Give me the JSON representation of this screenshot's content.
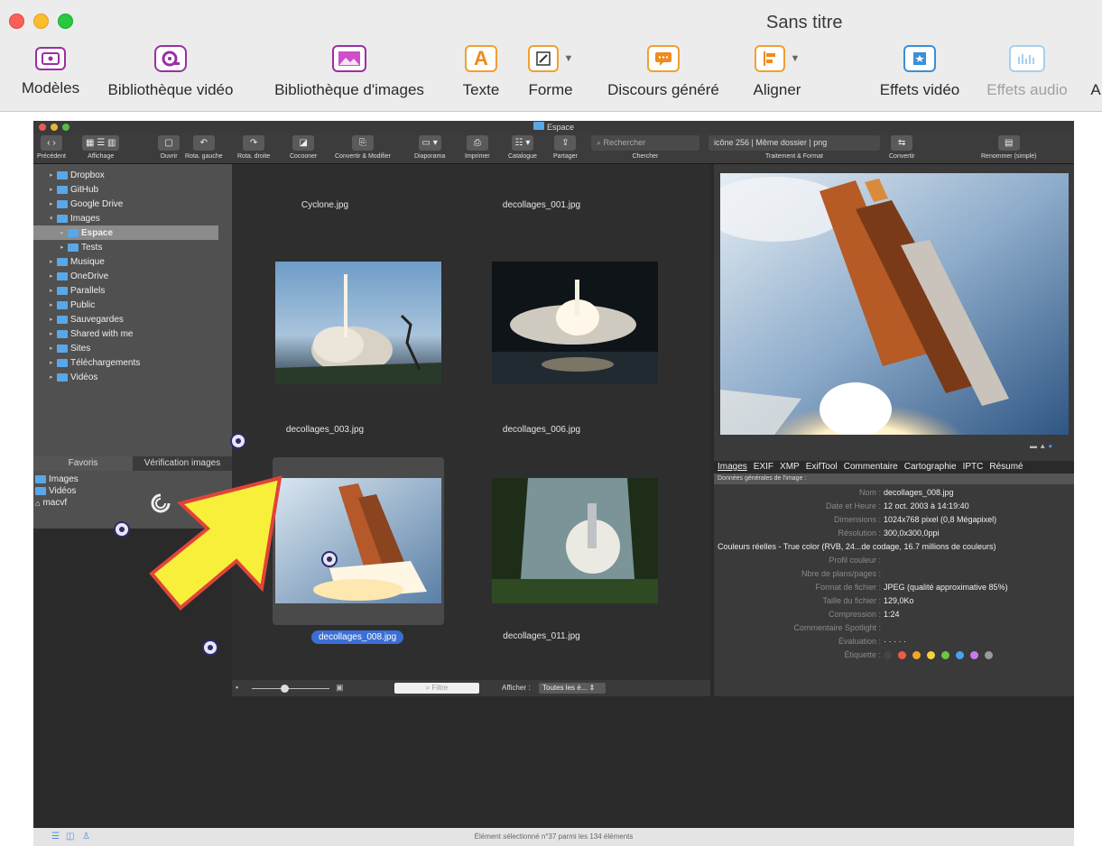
{
  "window": {
    "title": "Sans titre"
  },
  "toolbar": {
    "items": [
      {
        "label": "Modèles",
        "icon": "templates-icon"
      },
      {
        "label": "Bibliothèque vidéo",
        "icon": "video-library-icon"
      },
      {
        "label": "Bibliothèque d'images",
        "icon": "image-library-icon"
      },
      {
        "label": "Texte",
        "icon": "text-icon",
        "glyph": "A"
      },
      {
        "label": "Forme",
        "icon": "shape-icon"
      },
      {
        "label": "Discours généré",
        "icon": "speech-icon"
      },
      {
        "label": "Aligner",
        "icon": "align-icon"
      },
      {
        "label": "Effets vidéo",
        "icon": "video-effects-icon"
      },
      {
        "label": "Effets audio",
        "icon": "audio-effects-icon"
      },
      {
        "label": "A"
      }
    ]
  },
  "inner_window": {
    "title": "Espace",
    "toolbar": {
      "precedent": "Précédent",
      "affichage": "Affichage",
      "ouvrir": "Ouvrir",
      "rota_gauche": "Rota. gauche",
      "rota_droite": "Rota. droite",
      "cocooner": "Cocooner",
      "convertir_modifier": "Convertir & Modifier",
      "diaporama": "Diaporama",
      "imprimer": "Imprimer",
      "catalogue": "Catalogue",
      "partager": "Partager",
      "search_placeholder": "Rechercher",
      "chercher": "Chercher",
      "format_value": "icône 256 | Même dossier | png",
      "traitement": "Traitement & Format",
      "convertir": "Convertir",
      "renommer": "Renommer (simple)"
    },
    "sidebar": {
      "tree": [
        {
          "label": "Dropbox",
          "indent": 1
        },
        {
          "label": "GitHub",
          "indent": 1
        },
        {
          "label": "Google Drive",
          "indent": 1
        },
        {
          "label": "Images",
          "indent": 1
        },
        {
          "label": "Espace",
          "indent": 2
        },
        {
          "label": "Tests",
          "indent": 2
        },
        {
          "label": "Musique",
          "indent": 1
        },
        {
          "label": "OneDrive",
          "indent": 1
        },
        {
          "label": "Parallels",
          "indent": 1
        },
        {
          "label": "Public",
          "indent": 1
        },
        {
          "label": "Sauvegardes",
          "indent": 1
        },
        {
          "label": "Shared with me",
          "indent": 1
        },
        {
          "label": "Sites",
          "indent": 1
        },
        {
          "label": "Téléchargements",
          "indent": 1
        },
        {
          "label": "Vidéos",
          "indent": 1
        }
      ],
      "tabs": [
        "Favoris",
        "Vérification images"
      ],
      "favorites": [
        "Images",
        "Vidéos",
        "macvf"
      ]
    },
    "grid": {
      "captions": [
        "Cyclone.jpg",
        "decollages_001.jpg",
        "decollages_003.jpg",
        "decollages_006.jpg",
        "decollages_008.jpg",
        "decollages_011.jpg"
      ],
      "selected": "decollages_008.jpg",
      "filter_placeholder": "Filtre",
      "afficher_label": "Afficher :",
      "afficher_value": "Toutes les é..."
    },
    "info": {
      "tabs": [
        "Images",
        "EXIF",
        "XMP",
        "ExifTool",
        "Commentaire",
        "Cartographie",
        "IPTC",
        "Résumé"
      ],
      "header": "Données générales de l'image :",
      "rows": [
        {
          "k": "Nom :",
          "v": "decollages_008.jpg"
        },
        {
          "k": "Date et Heure :",
          "v": "12 oct. 2003 à 14:19:40"
        },
        {
          "k": "Dimensions :",
          "v": "1024x768 pixel (0,8 Mégapixel)"
        },
        {
          "k": "Résolution :",
          "v": "300,0x300,0ppi"
        },
        {
          "k": "",
          "v": "Couleurs réelles - True color (RVB, 24...de codage, 16.7 millions de couleurs)"
        },
        {
          "k": "Profil couleur :",
          "v": ""
        },
        {
          "k": "Nbre de plans/pages :",
          "v": ""
        },
        {
          "k": "Format de fichier :",
          "v": "JPEG (qualité approximative 85%)"
        },
        {
          "k": "Taille du fichier :",
          "v": "129,0Ko"
        },
        {
          "k": "Compression :",
          "v": "1:24"
        },
        {
          "k": "Commentaire Spotlight :",
          "v": ""
        },
        {
          "k": "Évaluation :",
          "v": "· · · · ·"
        },
        {
          "k": "Étiquette :",
          "v": ""
        }
      ],
      "label_colors": [
        "#444444",
        "#f05a4a",
        "#f5a623",
        "#f3d23a",
        "#6cc644",
        "#4a9ff5",
        "#c77de8",
        "#9a9a9a"
      ]
    },
    "status": "Élément sélectionné n°37 parmi les 134 éléments"
  },
  "colors": {
    "arrow_fill": "#f7ef3a",
    "arrow_stroke": "#e0443a",
    "selection_blue": "#3b6fd6"
  }
}
